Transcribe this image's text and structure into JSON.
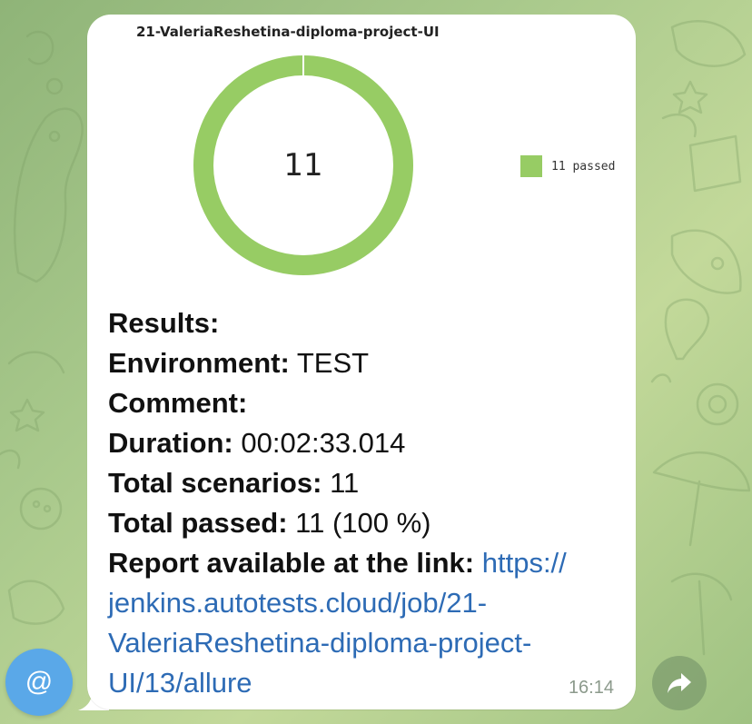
{
  "chart_data": {
    "type": "pie",
    "title": "21-ValeriaReshetina-diploma-project-UI",
    "center_label": "11",
    "categories": [
      "11 passed"
    ],
    "values": [
      11
    ],
    "colors": [
      "#97cc64"
    ],
    "legend_position": "right",
    "donut": true
  },
  "message": {
    "results_label": "Results:",
    "environment_label": "Environment:",
    "environment_value": "TEST",
    "comment_label": "Comment:",
    "duration_label": "Duration:",
    "duration_value": "00:02:33.014",
    "total_scenarios_label": "Total scenarios:",
    "total_scenarios_value": "11",
    "total_passed_label": "Total passed:",
    "total_passed_value": "11 (100 %)",
    "report_label": "Report available at the link:",
    "report_link_line1": "https://",
    "report_link_line2": "jenkins.autotests.cloud/job/21-",
    "report_link_line3": "ValeriaReshetina-diploma-project-",
    "report_link_line4": "UI/13/allure",
    "time": "16:14"
  },
  "buttons": {
    "mention_symbol": "@"
  },
  "icons": {
    "mention": "at-icon",
    "forward": "forward-arrow-icon"
  },
  "colors": {
    "link": "#2d6bb5",
    "passed": "#97cc64",
    "mention_button": "#5aa8e8"
  }
}
